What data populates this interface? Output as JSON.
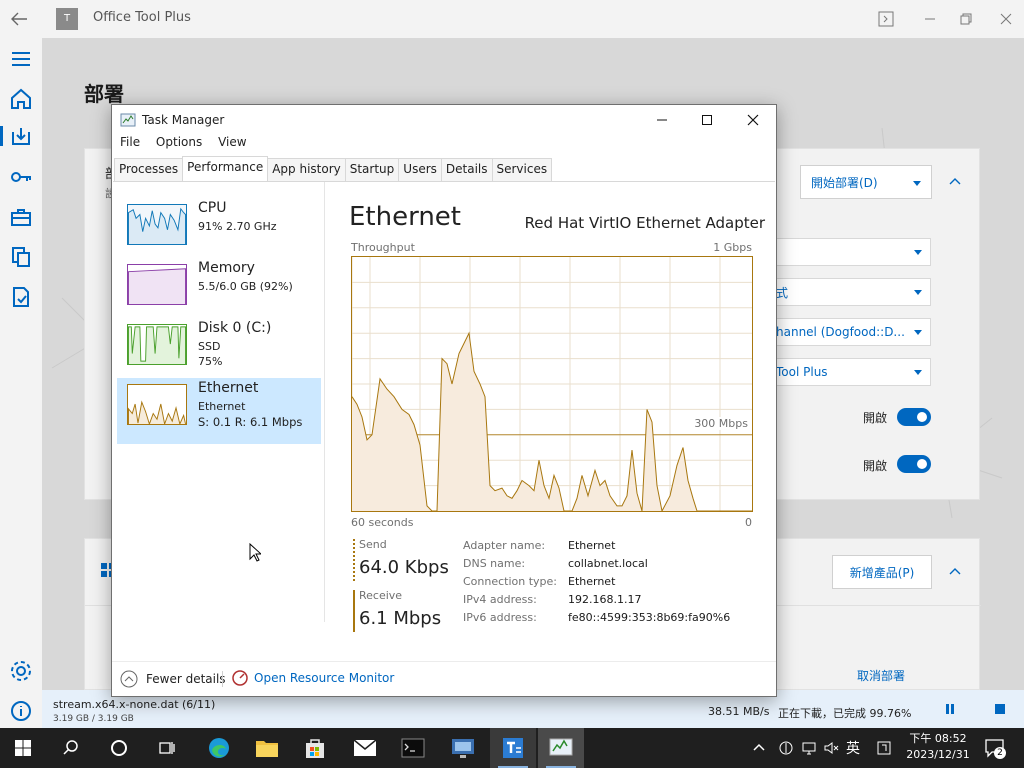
{
  "otp": {
    "app_title": "Office Tool Plus",
    "heading": "部署",
    "card1": {
      "title_partial": "部",
      "sub_partial": "設",
      "deploy_button": "開始部署(D)",
      "dropdowns": [
        "",
        "式",
        "hannel (Dogfood::D...",
        "Tool Plus"
      ],
      "toggle_labels": [
        "開啟",
        "開啟"
      ]
    },
    "card2": {
      "add_product_button": "新增產品(P)"
    },
    "cancel_link": "取消部署",
    "status": {
      "file": "stream.x64.x-none.dat (6/11)",
      "size": "3.19 GB / 3.19 GB",
      "speed": "38.51 MB/s",
      "progress_text": "正在下載，已完成 99.76%"
    }
  },
  "task_manager": {
    "title": "Task Manager",
    "menu": [
      "File",
      "Options",
      "View"
    ],
    "tabs": [
      "Processes",
      "Performance",
      "App history",
      "Startup",
      "Users",
      "Details",
      "Services"
    ],
    "active_tab": "Performance",
    "sidebar": [
      {
        "name": "CPU",
        "line1": "91%  2.70 GHz",
        "line2": "",
        "line3": "",
        "color": "#1178b8"
      },
      {
        "name": "Memory",
        "line1": "5.5/6.0 GB (92%)",
        "line2": "",
        "line3": "",
        "color": "#8b3fa8"
      },
      {
        "name": "Disk 0 (C:)",
        "line1": "SSD",
        "line2": "75%",
        "line3": "",
        "color": "#4aa02c"
      },
      {
        "name": "Ethernet",
        "line1": "Ethernet",
        "line2": "S: 0.1  R: 6.1 Mbps",
        "line3": "",
        "color": "#a8770f"
      }
    ],
    "panel": {
      "title": "Ethernet",
      "adapter": "Red Hat VirtIO Ethernet Adapter",
      "throughput_label": "Throughput",
      "max_label": "1 Gbps",
      "mid_label": "300 Mbps",
      "time_label": "60 seconds",
      "zero_label": "0",
      "send_label": "Send",
      "send_value": "64.0 Kbps",
      "receive_label": "Receive",
      "receive_value": "6.1 Mbps",
      "info": [
        {
          "k": "Adapter name:",
          "v": "Ethernet"
        },
        {
          "k": "DNS name:",
          "v": "collabnet.local"
        },
        {
          "k": "Connection type:",
          "v": "Ethernet"
        },
        {
          "k": "IPv4 address:",
          "v": "192.168.1.17"
        },
        {
          "k": "IPv6 address:",
          "v": "fe80::4599:353:8b69:fa90%6"
        }
      ]
    },
    "footer": {
      "fewer": "Fewer details",
      "monitor": "Open Resource Monitor"
    }
  },
  "taskbar": {
    "time": "下午 08:52",
    "date": "2023/12/31",
    "ime": "英",
    "notifications": "2"
  }
}
